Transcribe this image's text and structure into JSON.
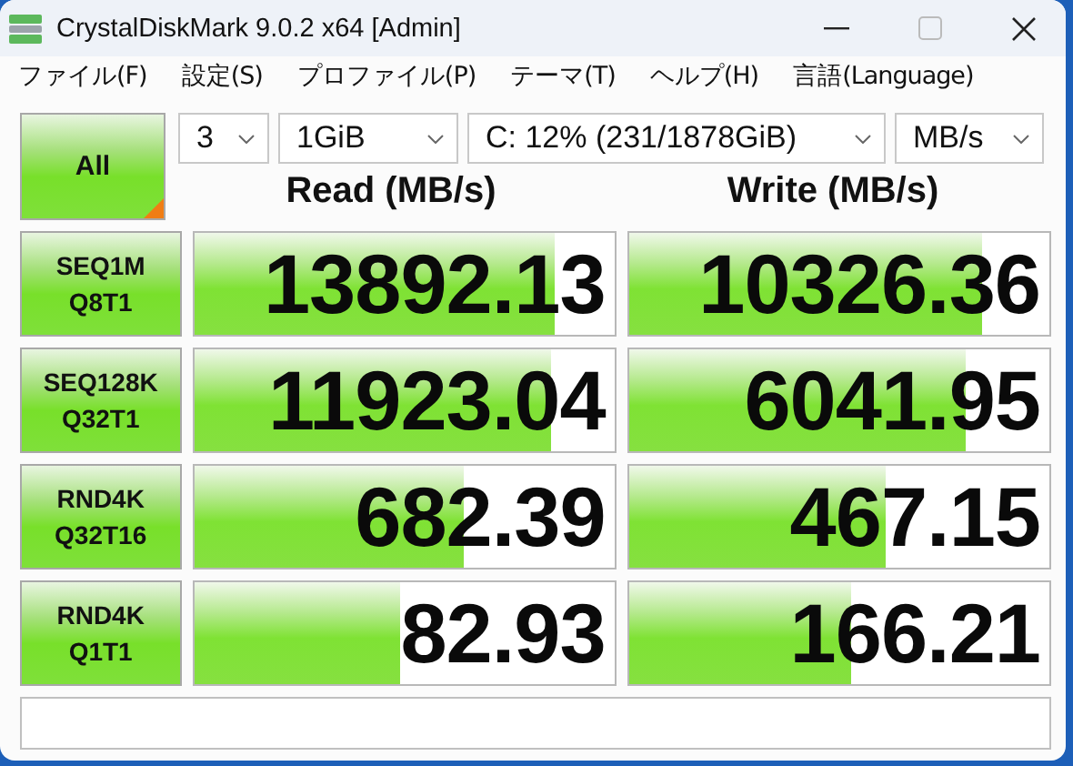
{
  "window": {
    "title": "CrystalDiskMark 9.0.2 x64 [Admin]"
  },
  "menu": [
    "ファイル(F)",
    "設定(S)",
    "プロファイル(P)",
    "テーマ(T)",
    "ヘルプ(H)",
    "言語(Language)"
  ],
  "all_button": "All",
  "selects": [
    {
      "value": "3"
    },
    {
      "value": "1GiB"
    },
    {
      "value": "C: 12% (231/1878GiB)"
    },
    {
      "value": "MB/s"
    }
  ],
  "headers": [
    "Read (MB/s)",
    "Write (MB/s)"
  ],
  "rows": [
    {
      "test": "SEQ1M",
      "params": "Q8T1",
      "read": {
        "value": "13892.13",
        "level": 0.86
      },
      "write": {
        "value": "10326.36",
        "level": 0.84
      }
    },
    {
      "test": "SEQ128K",
      "params": "Q32T1",
      "read": {
        "value": "11923.04",
        "level": 0.85
      },
      "write": {
        "value": "6041.95",
        "level": 0.8
      }
    },
    {
      "test": "RND4K",
      "params": "Q32T16",
      "read": {
        "value": "682.39",
        "level": 0.64
      },
      "write": {
        "value": "467.15",
        "level": 0.61
      }
    },
    {
      "test": "RND4K",
      "params": "Q1T1",
      "read": {
        "value": "82.93",
        "level": 0.49
      },
      "write": {
        "value": "166.21",
        "level": 0.53
      }
    }
  ]
}
